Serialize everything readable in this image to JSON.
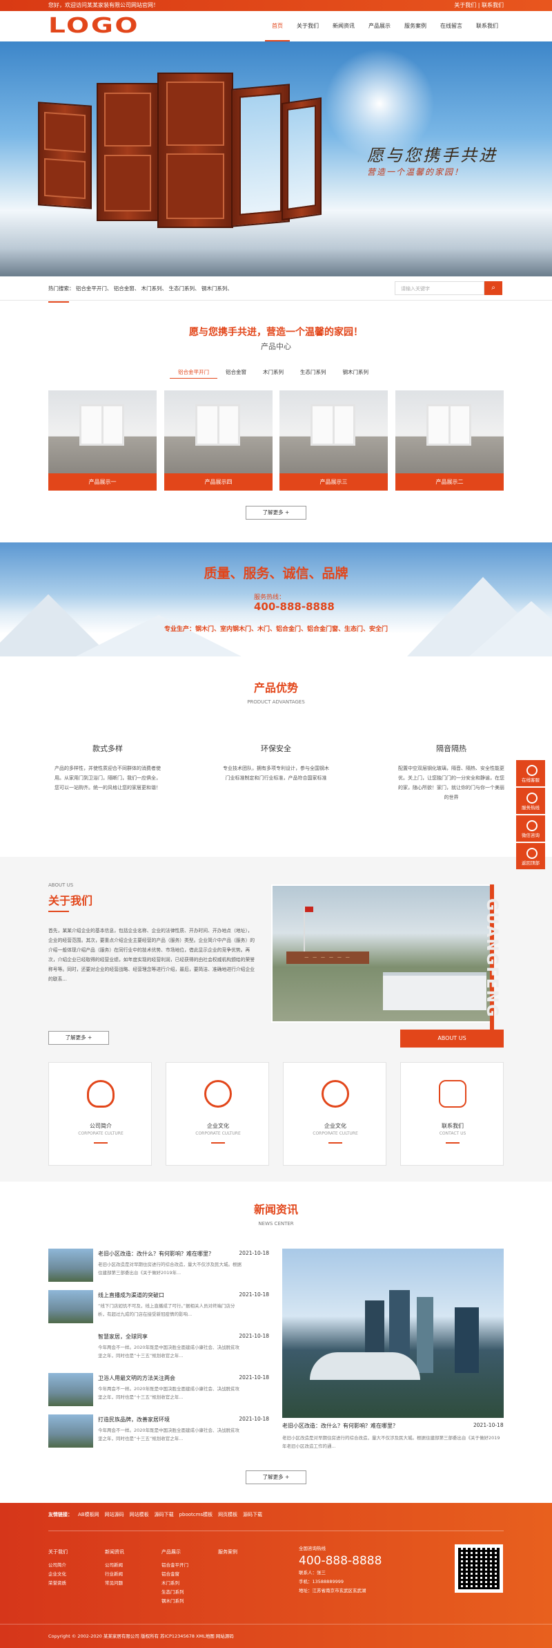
{
  "topbar": {
    "welcome": "您好，欢迎访问某某家装有限公司网站官网！",
    "links": "关于我们  |  联系我们"
  },
  "header": {
    "logo": "LOGO",
    "nav": [
      "首页",
      "关于我们",
      "新闻资讯",
      "产品展示",
      "服务案例",
      "在线留言",
      "联系我们"
    ]
  },
  "banner": {
    "slogan": "愿与您携手共进",
    "sub": "营造一个温馨的家园！"
  },
  "search": {
    "hot": "热门搜索： 铝合金平开门、 铝合金窗、 木门系列、 生态门系列、 钢木门系列、",
    "placeholder": "请输入关键字",
    "icon": "search-icon"
  },
  "products": {
    "slogan": "愿与您携手共进，营造一个温馨的家园！",
    "title": "产品中心",
    "tabs": [
      "铝合金平开门",
      "铝合金窗",
      "木门系列",
      "生态门系列",
      "钢木门系列"
    ],
    "items": [
      "产品展示一",
      "产品展示四",
      "产品展示三",
      "产品展示二"
    ],
    "more": "了解更多 +"
  },
  "band": {
    "title": "质量、服务、诚信、品牌",
    "hotline_label": "服务热线：",
    "hotline": "400-888-8888",
    "specialty": "专业生产：钢木门、室内钢木门、木门、铝合金门、铝合金门窗、生态门、安全门"
  },
  "advantages": {
    "title": "产品优势",
    "subtitle": "PRODUCT ADVANTAGES",
    "items": [
      {
        "title": "款式多样",
        "desc": "产品的多样性，并使性质迎合不同群体的消费者使用。从家用门到卫浴门，隔断门，我们一应俱全，您可以一站购齐。统一的风格让您的家居更和谐！"
      },
      {
        "title": "环保安全",
        "desc": "专业技术团队，拥有多项专利设计，参与全国钢木门业标准制定和门行业标准，产品符合国家标准"
      },
      {
        "title": "隔音隔热",
        "desc": "配置中空双层钢化玻璃，隔音、隔热、安全性能更优。关上门，让您独门门的一分安全和静谧，在您的家，随心所欲！家门，就让你的门与你一个美丽的世界"
      }
    ]
  },
  "about": {
    "label": "ABOUT US",
    "title": "关于我们",
    "text": "首先，某某介绍企业的基本信息，包括企业名称、企业的法律性质、开办时间、开办地点（地址），企业的经营范围。其次，要重点介绍企业主要经营的产品（服务）类型。企业简介中产品（服务）的介绍一般体现介绍产品（服务）在同行业中的技术优势、市场地位，借此显示企业的竞争优势。再次，介绍企业已经取得的经营业绩，如年度实现的经营利润，已经获得的由社会权威机构颁给的荣誉称号等。同时，还要对企业的经营战略、经营理念等进行介绍，最后，要简洁、准确地进行介绍企业的联系...",
    "more": "了解更多 +",
    "tag": "ABOUT US",
    "side_text": "GUANGFENG",
    "cards": [
      {
        "icon": "lightbulb-icon",
        "title": "公司简介",
        "en": "CORPORATE CULTURE"
      },
      {
        "icon": "globe-icon",
        "title": "企业文化",
        "en": "CORPORATE CULTURE"
      },
      {
        "icon": "globe-icon",
        "title": "企业文化",
        "en": "CORPORATE CULTURE"
      },
      {
        "icon": "phone-icon",
        "title": "联系我们",
        "en": "CONTACT US"
      }
    ]
  },
  "news": {
    "title": "新闻资讯",
    "subtitle": "NEWS CENTER",
    "items": [
      {
        "title": "老旧小区改造：改什么？有何影响？难在哪里？",
        "date": "2021-10-18",
        "desc": "老旧小区改造是对早期住房进行的综合改造，量大不仅涉及民大城。根据住建部第三部委出台《关于做好2019年..."
      },
      {
        "title": "线上直播成为渠道的突破口",
        "date": "2021-10-18",
        "desc": "“线下门店如饥不可及，线上直播成了可行。”据相关人员对终端门店分析，有超过九成的门店在接受新冠疫情的影响..."
      },
      {
        "title": "智慧家居，全球同享",
        "date": "2021-10-18",
        "desc": "今年两会不一样。2020年既是中国决胜全面建成小康社会、决战脱贫攻坚之年，同时也是“十三五”规划收官之年..."
      },
      {
        "title": "卫浴人用最文明的方法关注两会",
        "date": "2021-10-18",
        "desc": "今年两会不一样。2020年既是中国决胜全面建成小康社会、决战脱贫攻坚之年，同时也是“十三五”规划收官之年..."
      },
      {
        "title": "打造民族品牌，改善家居环境",
        "date": "2021-10-18",
        "desc": "今年两会不一样。2020年既是中国决胜全面建成小康社会、决战脱贫攻坚之年，同时也是“十三五”规划收官之年..."
      }
    ],
    "featured": {
      "title": "老旧小区改造：改什么？有何影响？难在哪里？",
      "date": "2021-10-18",
      "desc": "老旧小区改造是对早期住房进行的综合改造，量大不仅涉及民大城。根据住建部第三部委出台《关于做好2019年老旧小区改造工作的通..."
    },
    "more": "了解更多 +"
  },
  "footer": {
    "links_label": "友情链接：",
    "links": [
      "AB模板网",
      "网站源码",
      "网站模板",
      "源码下载",
      "pbootcms模板",
      "网页模板",
      "源码下载"
    ],
    "cols": [
      {
        "title": "关于我们",
        "items": [
          "公司简介",
          "企业文化",
          "荣誉资质"
        ]
      },
      {
        "title": "新闻资讯",
        "items": [
          "公司新闻",
          "行业新闻",
          "常见问题"
        ]
      },
      {
        "title": "产品展示",
        "items": [
          "铝合金平开门",
          "铝合金窗",
          "木门系列",
          "生态门系列",
          "钢木门系列"
        ]
      },
      {
        "title": "服务案例",
        "items": []
      }
    ],
    "contact_title": "全国咨询热线",
    "phone": "400-888-8888",
    "contact_person": "联系人：张三",
    "mobile": "手机：13588889999",
    "address": "地址：江苏省南京市玄武区玄武湖",
    "copyright": "Copyright © 2002-2020 某某家居有限公司 版权所有 苏ICP12345678 XML地图 网站源码"
  },
  "sidebar": [
    "在线客服",
    "服务热线",
    "微信咨询",
    "返回顶部"
  ]
}
